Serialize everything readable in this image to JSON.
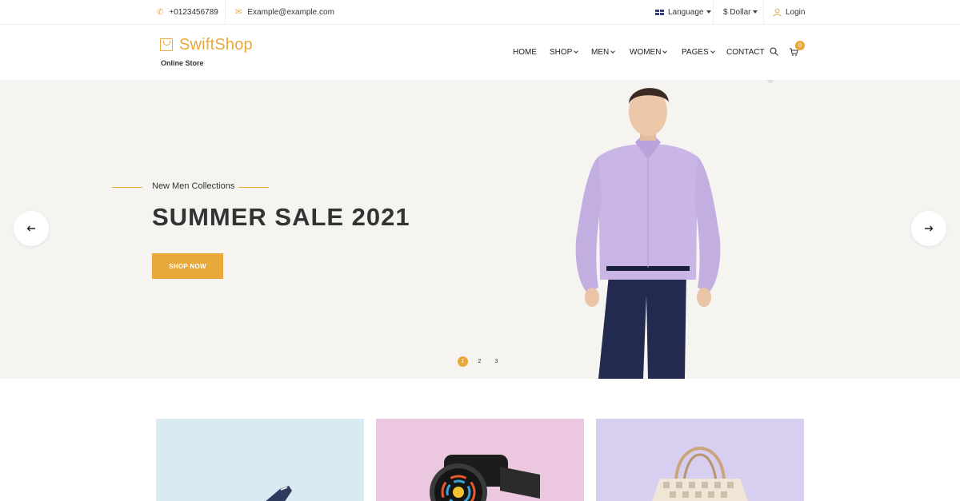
{
  "topbar": {
    "phone": "+0123456789",
    "email": "Example@example.com",
    "language": "Language",
    "currency": "$ Dollar",
    "login": "Login"
  },
  "brand": {
    "name": "SwiftShop",
    "tagline": "Online Store",
    "accent": "#e9a83a"
  },
  "nav": {
    "home": "HOME",
    "shop": "SHOP",
    "men": "MEN",
    "women": "WOMEN",
    "pages": "PAGES",
    "contact": "CONTACT",
    "cart_count": "0"
  },
  "hero": {
    "subtitle": "New Men Collections",
    "title": "SUMMER SALE 2021",
    "button": "SHOP NOW",
    "dots": [
      "1",
      "2",
      "3"
    ],
    "active_dot": 1
  },
  "categories": [
    {
      "bg": "#daeaf3",
      "product": "shoe"
    },
    {
      "bg": "#ebc7e0",
      "product": "smartwatch"
    },
    {
      "bg": "#d8cff0",
      "product": "handbag"
    }
  ],
  "icons": {
    "search": "search-icon",
    "cart": "cart-icon",
    "prev": "arrow-left-icon",
    "next": "arrow-right-icon"
  }
}
